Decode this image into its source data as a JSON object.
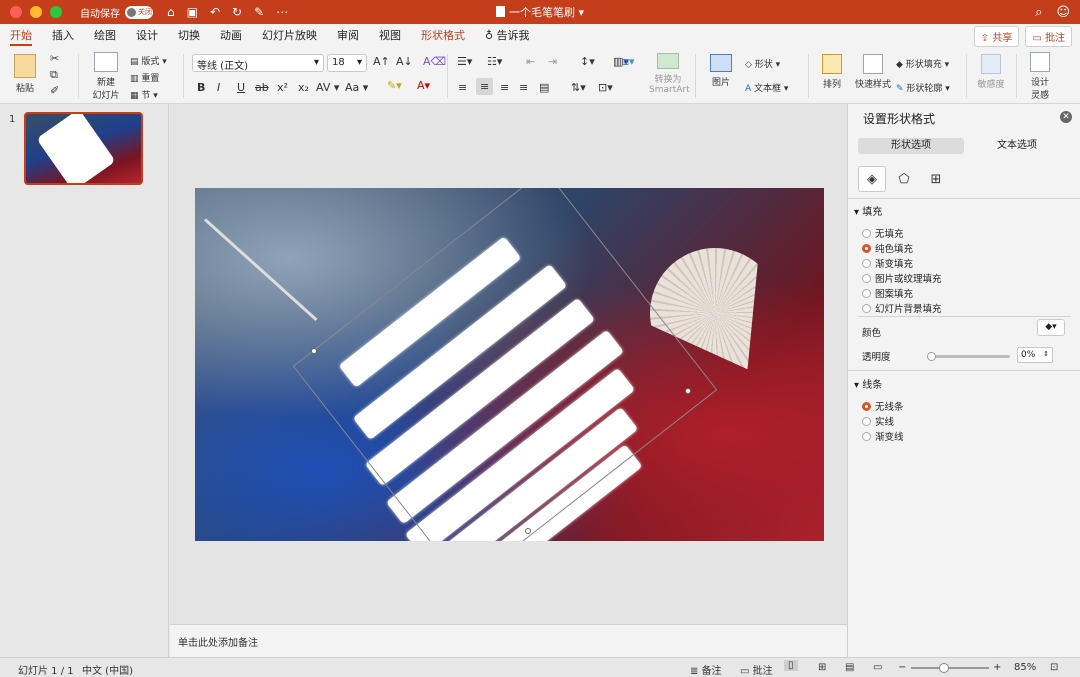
{
  "window": {
    "autosave_label": "自动保存",
    "autosave_state": "关闭",
    "title": "一个毛笔笔刷"
  },
  "tabs": [
    "开始",
    "插入",
    "绘图",
    "设计",
    "切换",
    "动画",
    "幻灯片放映",
    "审阅",
    "视图",
    "形状格式",
    "告诉我"
  ],
  "tab_right": {
    "share": "共享",
    "comment": "批注"
  },
  "ribbon": {
    "paste": "粘贴",
    "new_slide_1": "新建",
    "new_slide_2": "幻灯片",
    "layout": "版式",
    "reset": "重置",
    "section": "节",
    "font_name": "等线 (正文)",
    "font_size": "18",
    "bold": "B",
    "italic": "I",
    "underline": "U",
    "strike": "ab",
    "superscript": "x²",
    "subscript": "x₂",
    "spacing": "AV",
    "case": "Aa",
    "convert_smartart_1": "转换为",
    "convert_smartart_2": "SmartArt",
    "picture": "图片",
    "shape": "形状",
    "textbox": "文本框",
    "arrange": "排列",
    "quick_styles": "快速样式",
    "shape_fill": "形状填充",
    "shape_outline": "形状轮廓",
    "sensitivity": "敏感度",
    "designer_1": "设计",
    "designer_2": "灵感"
  },
  "slides_panel": {
    "slide_number": "1"
  },
  "notes_placeholder": "单击此处添加备注",
  "format_pane": {
    "title": "设置形状格式",
    "seg_shape": "形状选项",
    "seg_text": "文本选项",
    "fill_header": "填充",
    "fill_options": [
      "无填充",
      "纯色填充",
      "渐变填充",
      "图片或纹理填充",
      "图案填充",
      "幻灯片背景填充"
    ],
    "fill_selected": "纯色填充",
    "color_label": "颜色",
    "transparency_label": "透明度",
    "transparency_value": "0%",
    "transparency_fraction": 0,
    "line_header": "线条",
    "line_options": [
      "无线条",
      "实线",
      "渐变线"
    ],
    "line_selected": "无线条"
  },
  "statusbar": {
    "slide_info": "幻灯片 1 / 1",
    "language": "中文 (中国)",
    "notes": "备注",
    "comments": "批注",
    "zoom": "85%"
  }
}
